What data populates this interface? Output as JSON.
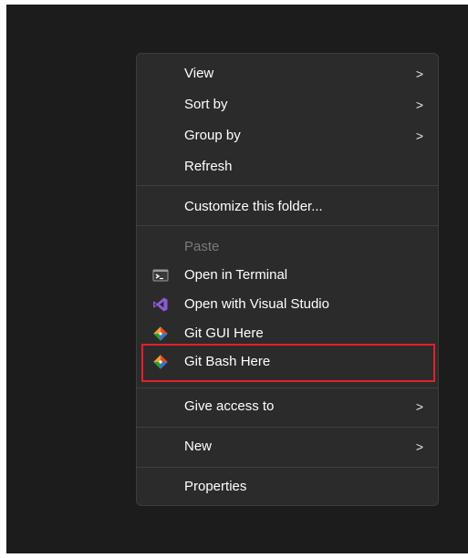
{
  "menu": {
    "items": [
      {
        "label": "View",
        "submenu": true
      },
      {
        "label": "Sort by",
        "submenu": true
      },
      {
        "label": "Group by",
        "submenu": true
      },
      {
        "label": "Refresh",
        "submenu": false
      },
      {
        "label": "Customize this folder...",
        "submenu": false
      },
      {
        "label": "Paste",
        "disabled": true
      },
      {
        "label": "Open in Terminal",
        "icon": "terminal-icon"
      },
      {
        "label": "Open with Visual Studio",
        "icon": "visual-studio-icon"
      },
      {
        "label": "Git GUI Here",
        "icon": "git-icon"
      },
      {
        "label": "Git Bash Here",
        "icon": "git-icon",
        "highlighted": true
      },
      {
        "label": "Give access to",
        "submenu": true
      },
      {
        "label": "New",
        "submenu": true
      },
      {
        "label": "Properties",
        "submenu": false
      }
    ],
    "chevron": ">"
  },
  "colors": {
    "background": "#1c1c1c",
    "menu": "#2b2b2b",
    "highlight_outline": "#e3202a",
    "disabled_text": "#7a7a7a"
  }
}
